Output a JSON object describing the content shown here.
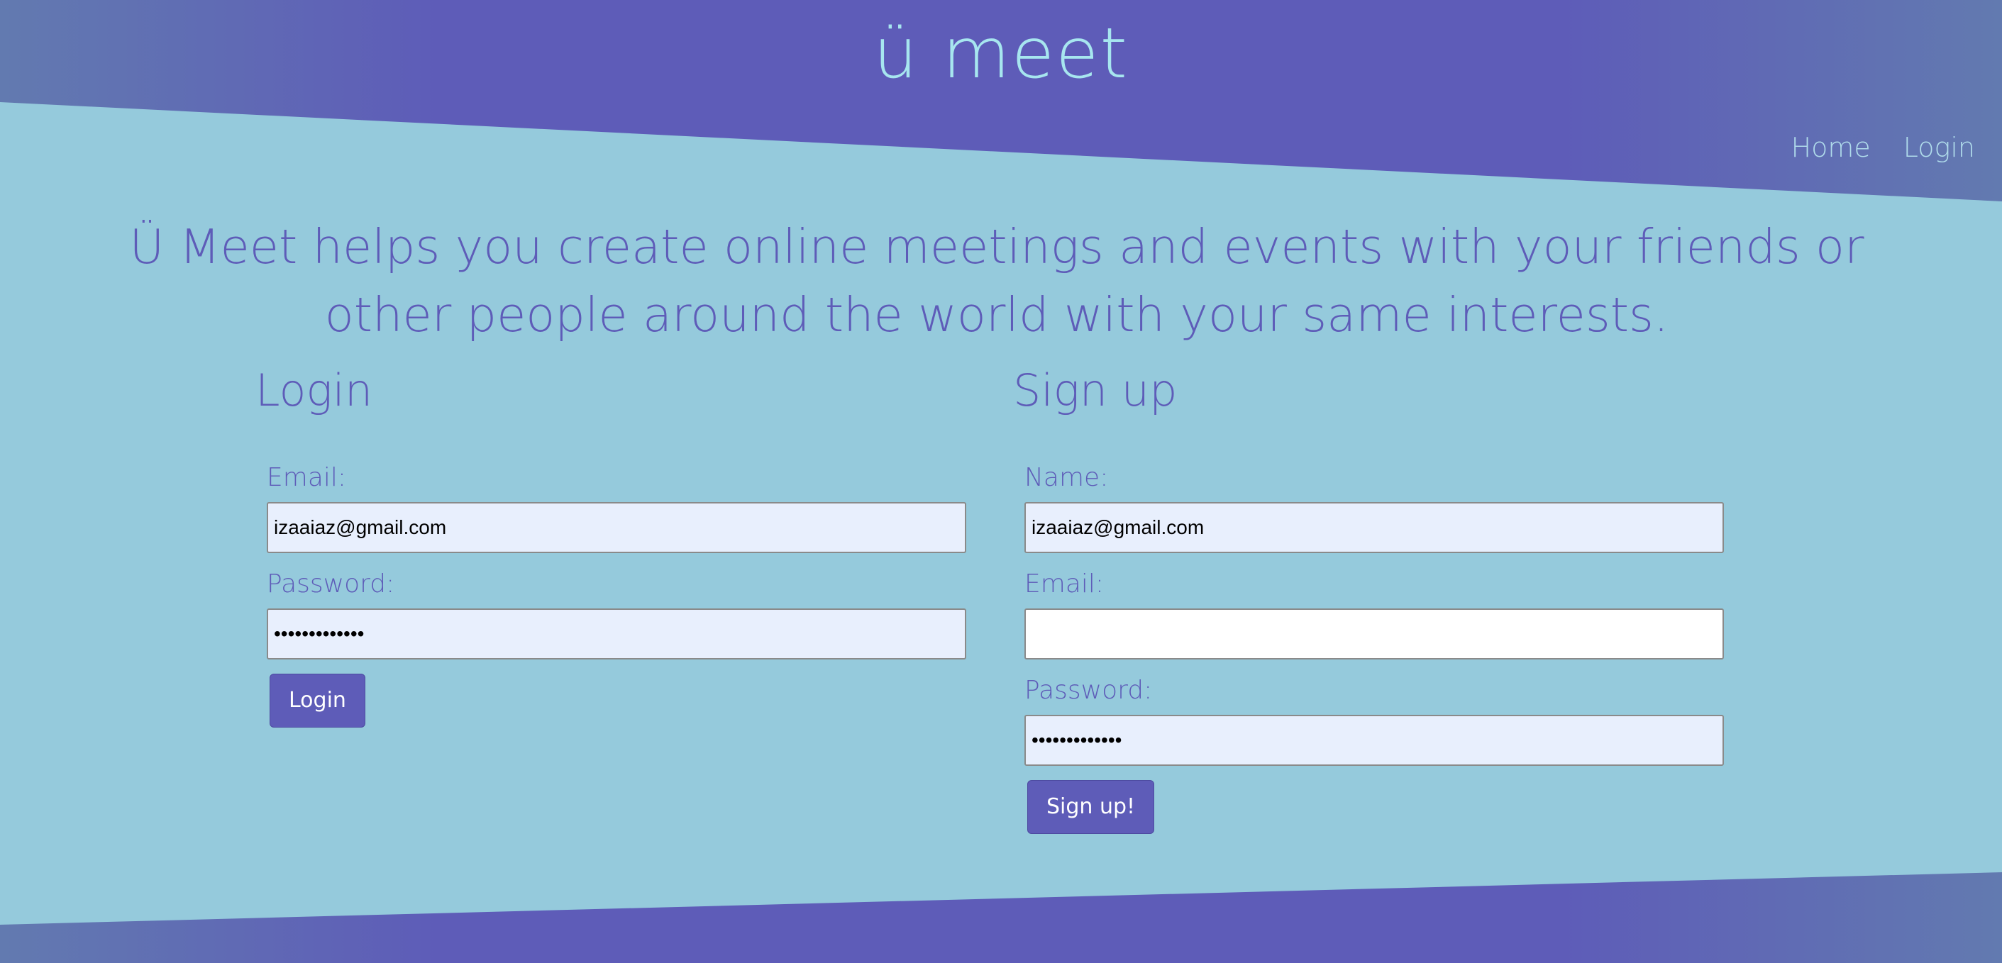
{
  "header": {
    "logo": "ü meet",
    "nav": {
      "home": "Home",
      "login": "Login"
    }
  },
  "tagline": "Ü Meet helps you create online meetings and events with your friends or other people around the world with your same interests.",
  "login_form": {
    "title": "Login",
    "email_label": "Email:",
    "email_value": "izaaiaz@gmail.com",
    "password_label": "Password:",
    "password_value": "•••••••••••••",
    "button_label": "Login"
  },
  "signup_form": {
    "title": "Sign up",
    "name_label": "Name:",
    "name_value": "izaaiaz@gmail.com",
    "email_label": "Email:",
    "email_value": "",
    "password_label": "Password:",
    "password_value": "•••••••••••••",
    "button_label": "Sign up!"
  },
  "colors": {
    "background": "#95cadc",
    "band": "#5e5cb8",
    "accent_text": "#5e5cb8",
    "logo": "#a7e6ef",
    "input_autofill": "#e8effd"
  }
}
